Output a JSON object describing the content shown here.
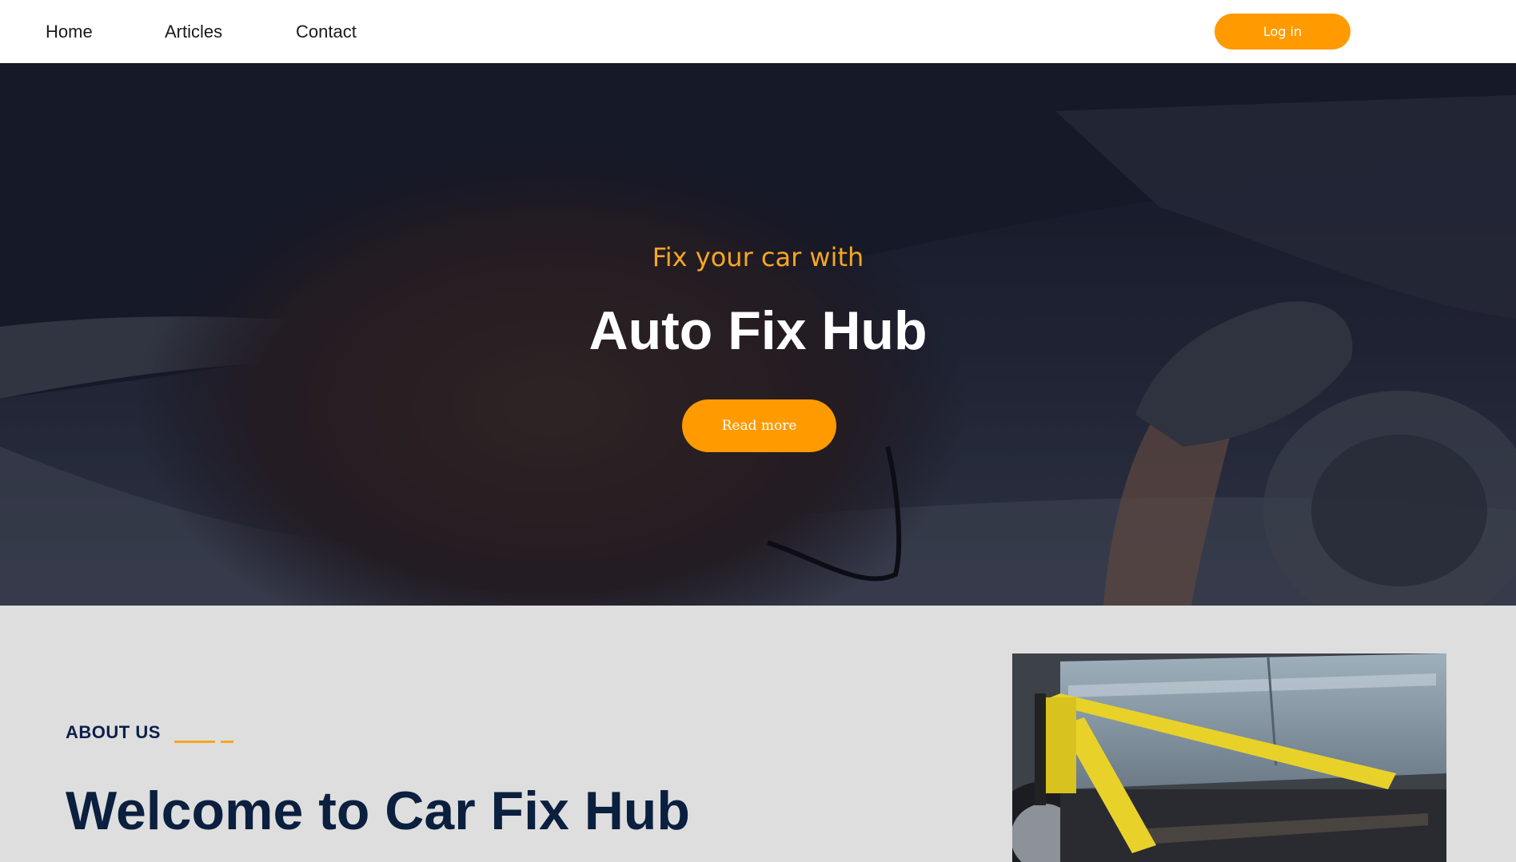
{
  "nav": {
    "links": [
      "Home",
      "Articles",
      "Contact"
    ],
    "login_label": "Log in"
  },
  "hero": {
    "subtitle": "Fix your car with",
    "title": "Auto Fix Hub",
    "button_label": "Read more"
  },
  "about": {
    "label": "ABOUT US",
    "title": "Welcome to Car Fix Hub"
  },
  "colors": {
    "accent": "#ff9a00",
    "subtitle": "#f5a623",
    "navy": "#0b1f4b",
    "section_bg": "#dedede"
  },
  "icons": {
    "hero_image": "mechanic-under-car-photo",
    "about_image": "car-on-lift-photo"
  }
}
